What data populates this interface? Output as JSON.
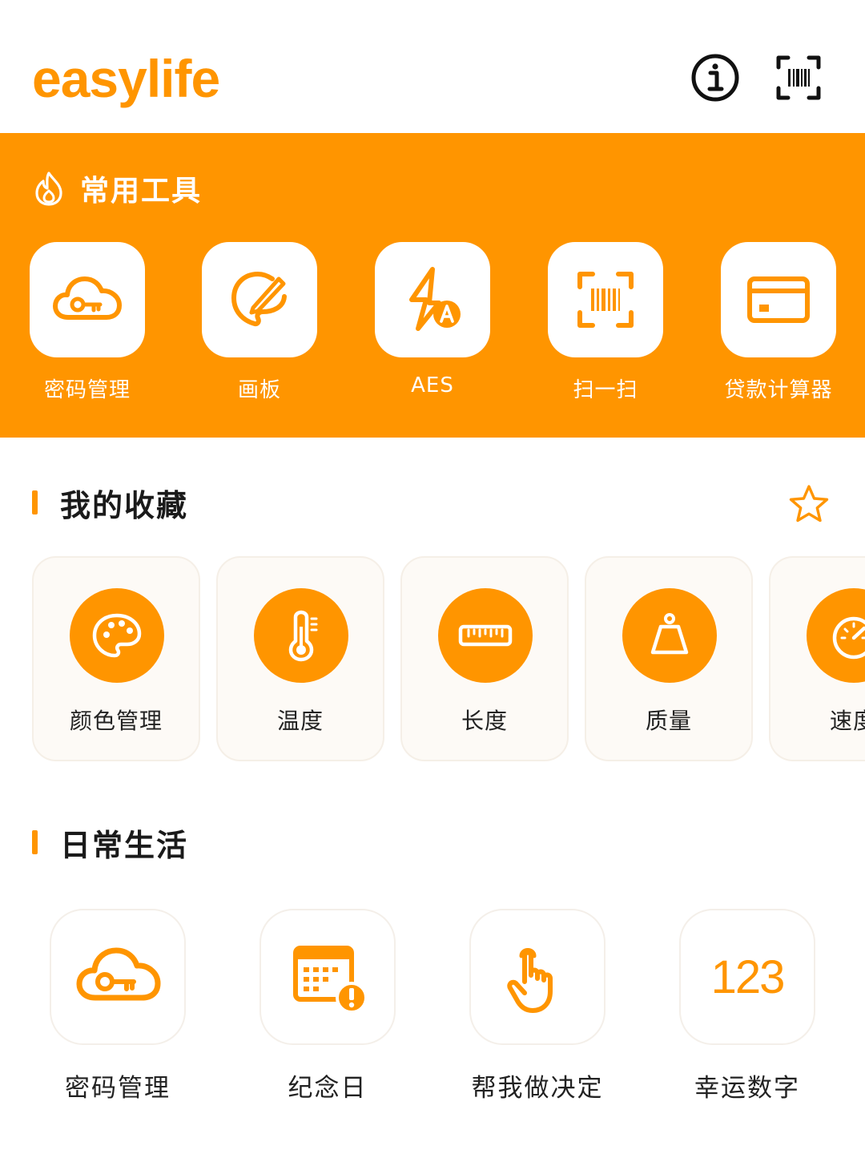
{
  "app": {
    "title": "easylife"
  },
  "header": {
    "info_icon": "info-circle-icon",
    "scan_icon": "barcode-scan-icon"
  },
  "common_tools": {
    "title": "常用工具",
    "icon": "flame-icon",
    "items": [
      {
        "label": "密码管理",
        "icon": "cloud-key-icon"
      },
      {
        "label": "画板",
        "icon": "drawing-board-icon"
      },
      {
        "label": "AES",
        "icon": "aes-lightning-icon"
      },
      {
        "label": "扫一扫",
        "icon": "barcode-scan-icon"
      },
      {
        "label": "贷款计算器",
        "icon": "credit-card-icon"
      }
    ]
  },
  "favorites": {
    "title": "我的收藏",
    "star_icon": "star-outline-icon",
    "items": [
      {
        "label": "颜色管理",
        "icon": "palette-icon"
      },
      {
        "label": "温度",
        "icon": "thermometer-icon"
      },
      {
        "label": "长度",
        "icon": "ruler-icon"
      },
      {
        "label": "质量",
        "icon": "weight-icon"
      },
      {
        "label": "速度",
        "icon": "speedometer-icon"
      }
    ]
  },
  "daily_life": {
    "title": "日常生活",
    "items": [
      {
        "label": "密码管理",
        "icon": "cloud-key-icon"
      },
      {
        "label": "纪念日",
        "icon": "calendar-alert-icon"
      },
      {
        "label": "帮我做决定",
        "icon": "hand-tap-icon"
      },
      {
        "label": "幸运数字",
        "icon": "lucky-number-icon",
        "glyph": "123"
      }
    ]
  },
  "colors": {
    "accent": "#FF9500",
    "card_bg": "#FDFAF6",
    "text": "#222222"
  }
}
